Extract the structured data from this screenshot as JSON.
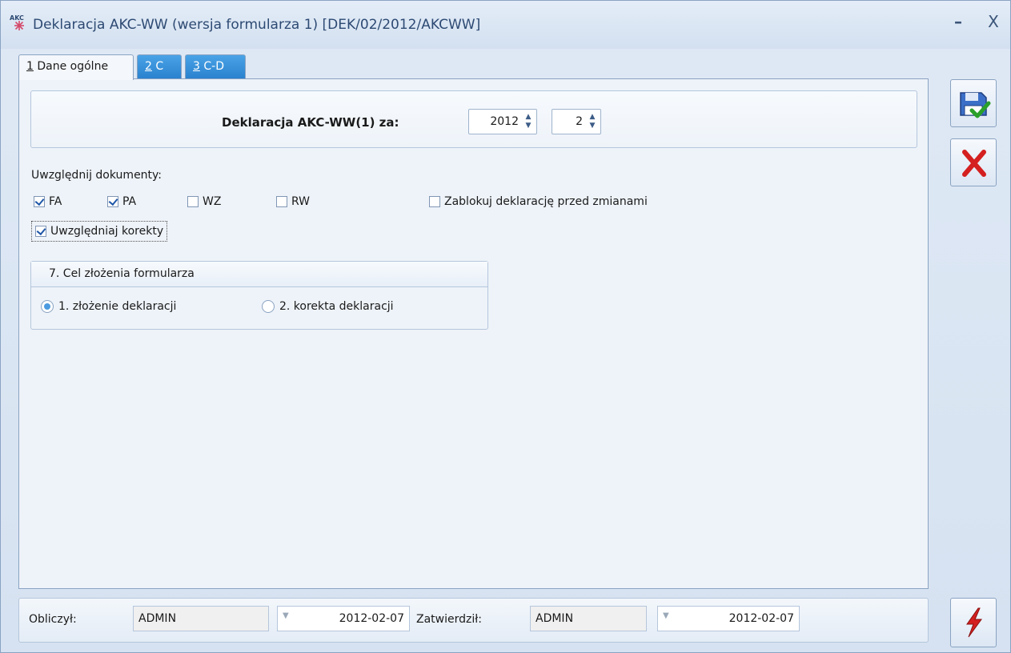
{
  "window": {
    "title": "Deklaracja AKC-WW (wersja formularza 1) [DEK/02/2012/AKCWW]",
    "icon": "akc-app-icon",
    "minimize_label": "–",
    "close_label": "X"
  },
  "tabs": [
    {
      "hotkey": "1",
      "label": " Dane ogólne",
      "active": true
    },
    {
      "hotkey": "2",
      "label": " C",
      "active": false
    },
    {
      "hotkey": "3",
      "label": " C-D",
      "active": false
    }
  ],
  "header": {
    "label": "Deklaracja AKC-WW(1) za:",
    "year": "2012",
    "month": "2"
  },
  "documents": {
    "label": "Uwzględnij dokumenty:",
    "items": [
      {
        "label": "FA",
        "checked": true
      },
      {
        "label": "PA",
        "checked": true
      },
      {
        "label": "WZ",
        "checked": false
      },
      {
        "label": "RW",
        "checked": false
      }
    ],
    "lock": {
      "label": "Zablokuj deklarację przed zmianami",
      "checked": false
    },
    "corrections": {
      "label": "Uwzględniaj korekty",
      "checked": true
    }
  },
  "goal": {
    "title": "7. Cel złożenia formularza",
    "options": [
      {
        "label": "1. złożenie deklaracji",
        "selected": true
      },
      {
        "label": "2. korekta deklaracji",
        "selected": false
      }
    ]
  },
  "footer": {
    "computed_label": "Obliczył:",
    "computed_user": "ADMIN",
    "computed_date": "2012-02-07",
    "approved_label": "Zatwierdził:",
    "approved_user": "ADMIN",
    "approved_date": "2012-02-07"
  },
  "buttons": {
    "save": "save-icon",
    "cancel": "cancel-icon",
    "calculate": "lightning-icon"
  },
  "colors": {
    "tab_inactive": "#2a82cf",
    "cancel_red": "#d42020",
    "check_blue": "#1f57a8"
  }
}
